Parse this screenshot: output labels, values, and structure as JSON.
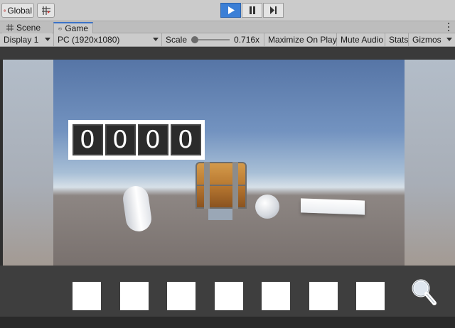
{
  "toolbar": {
    "global_label": "Global",
    "global_icon": "globe-icon",
    "grid_icon": "grid-snap-icon",
    "play_icon": "play-icon",
    "pause_icon": "pause-icon",
    "step_icon": "step-icon",
    "play_active_color": "#3b7fd6"
  },
  "tabs": [
    {
      "label": "Scene",
      "icon": "grid-icon"
    },
    {
      "label": "Game",
      "icon": "gamepad-icon",
      "active": true
    }
  ],
  "game_controls": {
    "display": "Display 1",
    "resolution": "PC (1920x1080)",
    "scale_label": "Scale",
    "scale_value": "0.716x",
    "maximize": "Maximize On Play",
    "mute": "Mute Audio",
    "stats": "Stats",
    "gizmos": "Gizmos"
  },
  "game": {
    "digits": [
      "0",
      "0",
      "0",
      "0"
    ],
    "inventory_slots": 7,
    "magnifier_icon": "magnifier-icon"
  }
}
